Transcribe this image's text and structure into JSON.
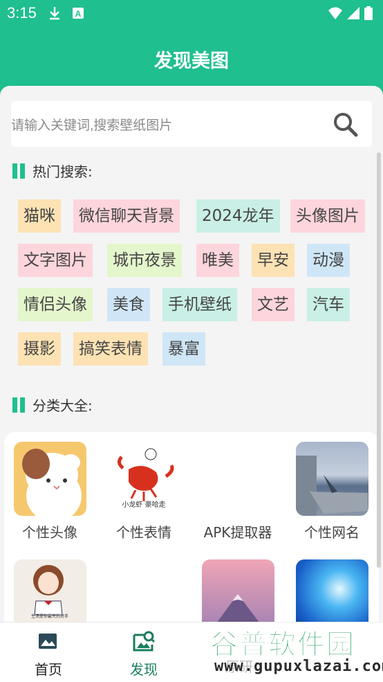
{
  "status": {
    "time": "3:15"
  },
  "header": {
    "title": "发现美图"
  },
  "search": {
    "placeholder": "请输入关键词,搜索壁纸图片"
  },
  "hot": {
    "title": "热门搜索:",
    "tags": [
      {
        "label": "猫咪",
        "color": "#fde2b4"
      },
      {
        "label": "微信聊天背景",
        "color": "#fdd5dc"
      },
      {
        "label": "2024龙年",
        "color": "#c9efe6"
      },
      {
        "label": "头像图片",
        "color": "#fdd5dc"
      },
      {
        "label": "文字图片",
        "color": "#fdd5dc"
      },
      {
        "label": "城市夜景",
        "color": "#e4f6cc"
      },
      {
        "label": "唯美",
        "color": "#fdd5dc"
      },
      {
        "label": "早安",
        "color": "#fde2b4"
      },
      {
        "label": "动漫",
        "color": "#cfe6f7"
      },
      {
        "label": "情侣头像",
        "color": "#e4f6cc"
      },
      {
        "label": "美食",
        "color": "#cfe6f7"
      },
      {
        "label": "手机壁纸",
        "color": "#c9efe6"
      },
      {
        "label": "文艺",
        "color": "#fdd5dc"
      },
      {
        "label": "汽车",
        "color": "#c9efe6"
      },
      {
        "label": "摄影",
        "color": "#fde2b4"
      },
      {
        "label": "搞笑表情",
        "color": "#fde2b4"
      },
      {
        "label": "暴富",
        "color": "#cfe6f7"
      }
    ]
  },
  "categories": {
    "title": "分类大全:",
    "items": [
      {
        "label": "个性头像"
      },
      {
        "label": "个性表情"
      },
      {
        "label": "APK提取器"
      },
      {
        "label": "个性网名"
      },
      {
        "label": ""
      },
      {
        "label": ""
      },
      {
        "label": ""
      }
    ]
  },
  "bottom_nav": {
    "items": [
      {
        "label": "首页",
        "active": false
      },
      {
        "label": "发现",
        "active": true
      },
      {
        "label": "原研",
        "active": false
      }
    ]
  },
  "watermark": {
    "big": "谷普软件园",
    "small": "www.gupuxlazai.com"
  },
  "colors": {
    "accent": "#1fbf8f",
    "active_nav": "#1a7e5a"
  }
}
